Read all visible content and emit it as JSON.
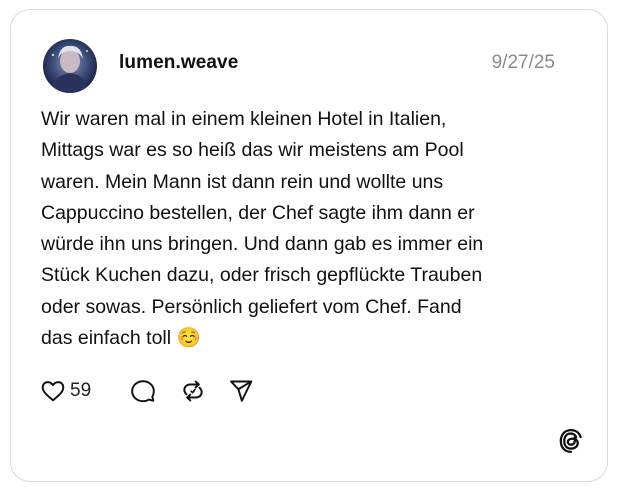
{
  "post": {
    "username": "lumen.weave",
    "date": "9/27/25",
    "lines": [
      "Wir waren mal in einem kleinen Hotel in Italien,",
      "Mittags war es so heiß das wir meistens am Pool",
      "waren. Mein Mann ist dann rein und wollte uns",
      "Cappuccino bestellen, der Chef sagte ihm dann er",
      "würde ihn uns bringen. Und dann gab es immer ein",
      "Stück Kuchen dazu, oder frisch gepflückte Trauben",
      "oder sowas. Persönlich geliefert vom Chef. Fand",
      "das einfach toll ☺️"
    ]
  },
  "actions": {
    "like_count": "59",
    "icons": [
      "heart-icon",
      "comment-icon",
      "repost-icon",
      "share-icon"
    ]
  },
  "brand": {
    "logo": "threads-logo-icon"
  },
  "colors": {
    "border": "#d9d9d9",
    "muted": "#8c8c8c",
    "text": "#111111"
  }
}
